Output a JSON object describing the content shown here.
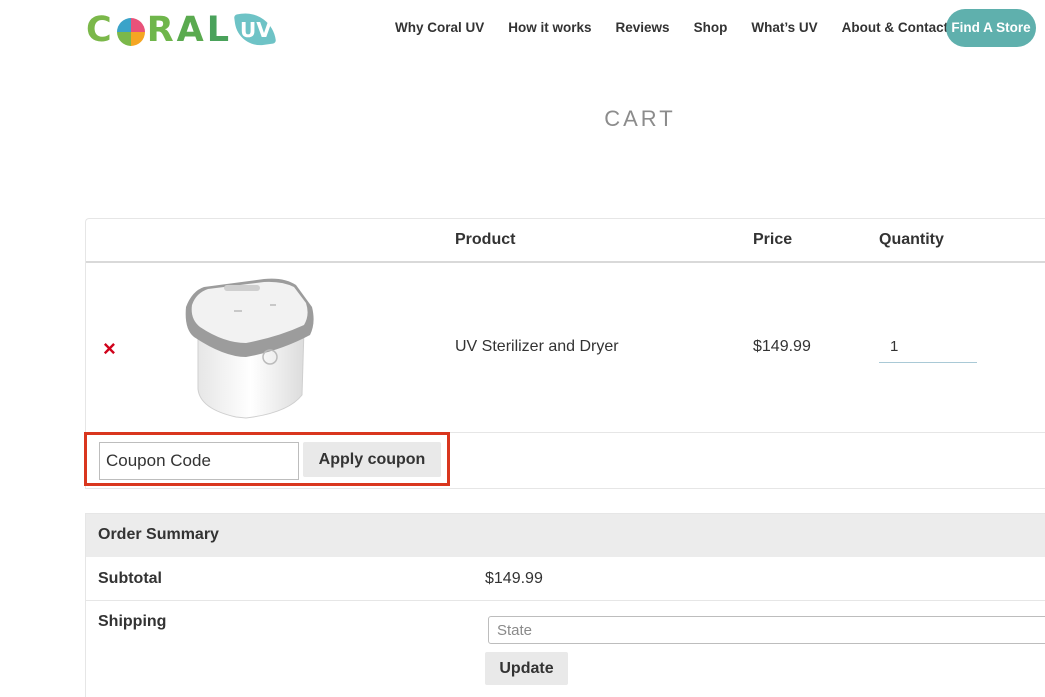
{
  "brand": {
    "logo_letters": [
      "C",
      "R",
      "A",
      "L"
    ],
    "logo_badge": "UV",
    "accent_color": "#5fb0ad"
  },
  "nav": {
    "items": [
      "Why Coral UV",
      "How it works",
      "Reviews",
      "Shop",
      "What’s UV",
      "About & Contact"
    ],
    "cta": "Find A Store"
  },
  "page": {
    "title": "CART"
  },
  "cart": {
    "headers": {
      "product": "Product",
      "price": "Price",
      "quantity": "Quantity"
    },
    "items": [
      {
        "remove_icon": "×",
        "image_icon": "uv-sterilizer-product-image",
        "name": "UV Sterilizer and Dryer",
        "price": "$149.99",
        "quantity": "1"
      }
    ],
    "coupon": {
      "placeholder": "Coupon Code",
      "apply_label": "Apply coupon",
      "highlight_color": "#d9361e"
    }
  },
  "summary": {
    "title": "Order Summary",
    "subtotal_label": "Subtotal",
    "subtotal_value": "$149.99",
    "shipping_label": "Shipping",
    "state_placeholder": "State",
    "update_label": "Update"
  }
}
